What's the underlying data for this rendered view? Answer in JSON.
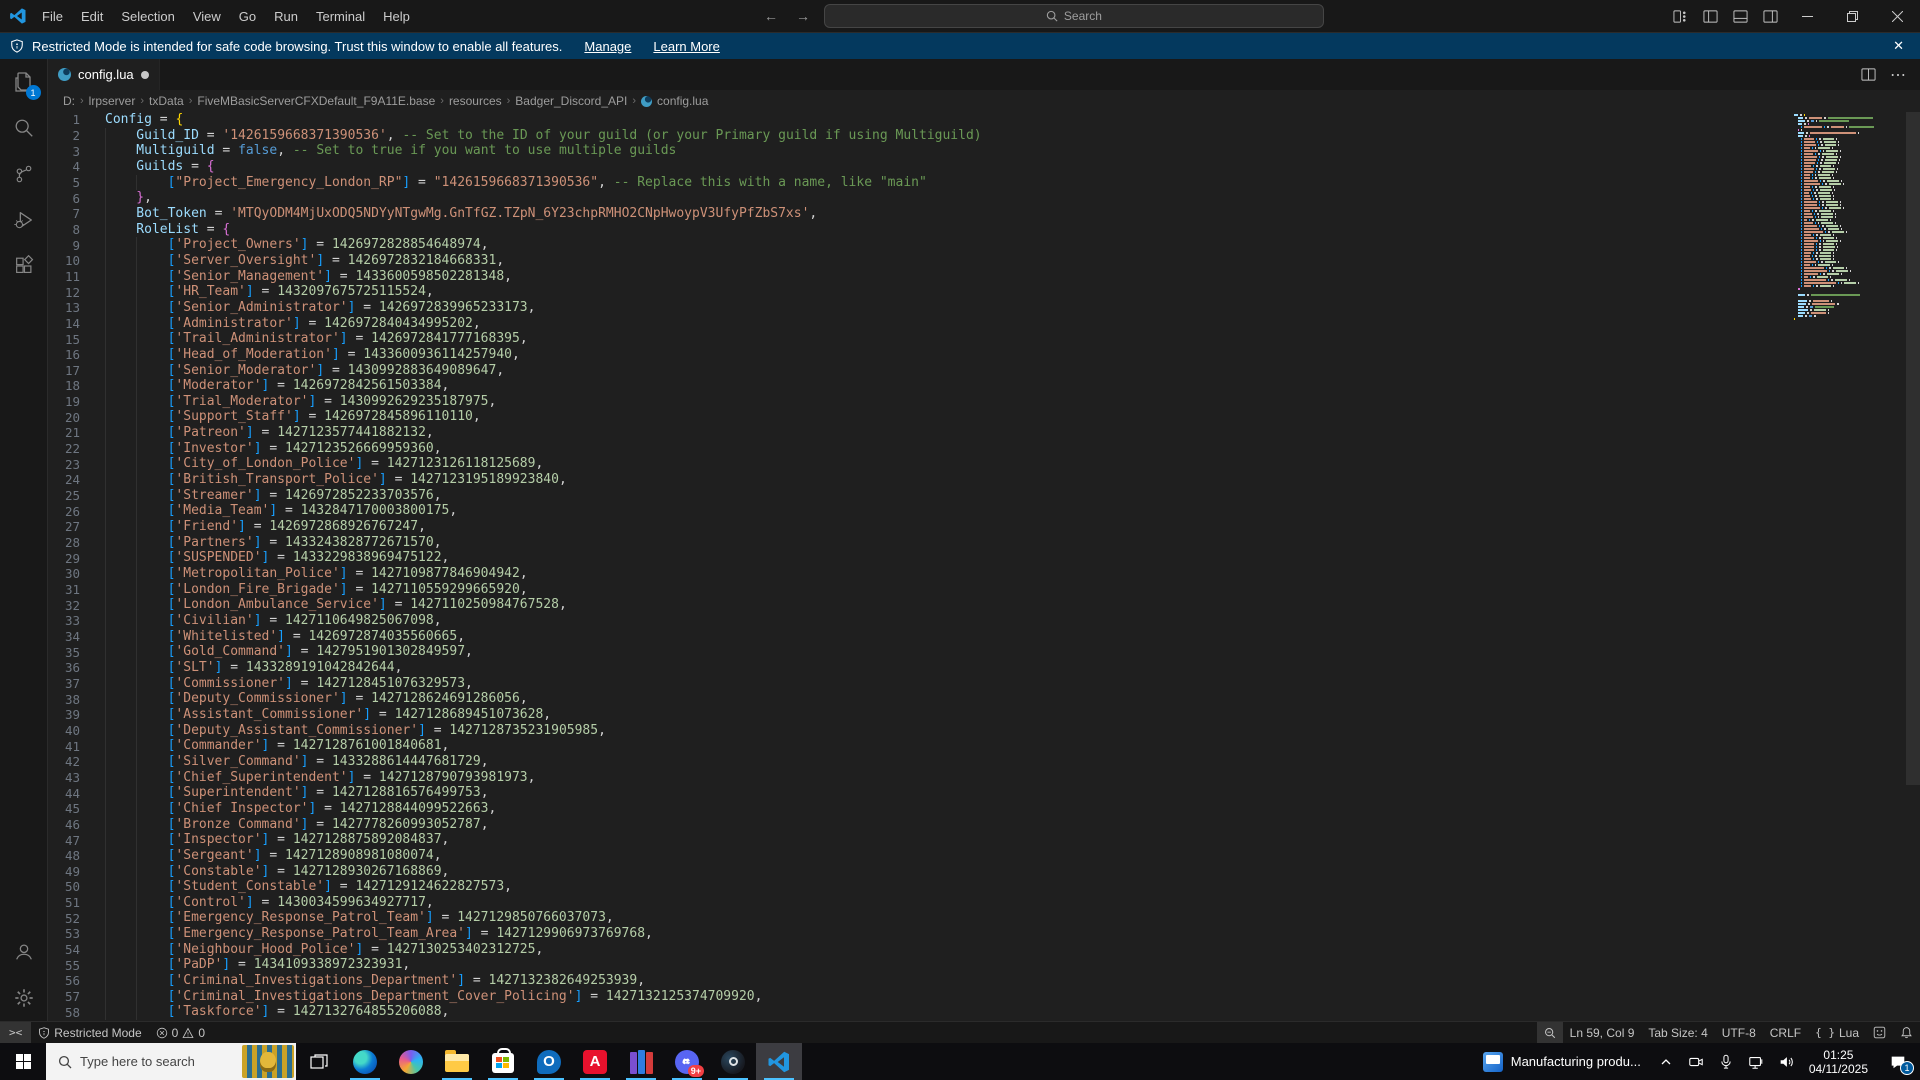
{
  "window": {
    "menus": [
      "File",
      "Edit",
      "Selection",
      "View",
      "Go",
      "Run",
      "Terminal",
      "Help"
    ],
    "search_placeholder": "Search"
  },
  "banner": {
    "text": "Restricted Mode is intended for safe code browsing. Trust this window to enable all features.",
    "manage": "Manage",
    "learn_more": "Learn More"
  },
  "tab": {
    "file": "config.lua"
  },
  "breadcrumb": [
    "D:",
    "lrpserver",
    "txData",
    "FiveMBasicServerCFXDefault_F9A11E.base",
    "resources",
    "Badger_Discord_API",
    "config.lua"
  ],
  "editor": {
    "head_lines": [
      {
        "ind": 0,
        "tokens": [
          [
            "v",
            "Config"
          ],
          [
            "o",
            " = "
          ],
          [
            "b1",
            "{"
          ]
        ]
      },
      {
        "ind": 1,
        "tokens": [
          [
            "v",
            "Guild_ID"
          ],
          [
            "o",
            " = "
          ],
          [
            "s",
            "'1426159668371390536'"
          ],
          [
            "o",
            ", "
          ],
          [
            "c",
            "-- Set to the ID of your guild (or your Primary guild if using Multiguild)"
          ]
        ]
      },
      {
        "ind": 1,
        "tokens": [
          [
            "v",
            "Multiguild"
          ],
          [
            "o",
            " = "
          ],
          [
            "k",
            "false"
          ],
          [
            "o",
            ", "
          ],
          [
            "c",
            "-- Set to true if you want to use multiple guilds"
          ]
        ]
      },
      {
        "ind": 1,
        "tokens": [
          [
            "v",
            "Guilds"
          ],
          [
            "o",
            " = "
          ],
          [
            "b2",
            "{"
          ]
        ]
      },
      {
        "ind": 2,
        "tokens": [
          [
            "b3",
            "["
          ],
          [
            "s",
            "\"Project_Emergency_London_RP\""
          ],
          [
            "b3",
            "]"
          ],
          [
            "o",
            " = "
          ],
          [
            "s",
            "\"1426159668371390536\""
          ],
          [
            "o",
            ", "
          ],
          [
            "c",
            "-- Replace this with a name, like \"main\""
          ]
        ]
      },
      {
        "ind": 1,
        "tokens": [
          [
            "b2",
            "}"
          ],
          [
            "o",
            ","
          ]
        ]
      },
      {
        "ind": 1,
        "tokens": [
          [
            "v",
            "Bot_Token"
          ],
          [
            "o",
            " = "
          ],
          [
            "s",
            "'MTQyODM4MjUxODQ5NDYyNTgwMg.GnTfGZ.TZpN_6Y23chpRMHO2CNpHwoypV3UfyPfZbS7xs'"
          ],
          [
            "o",
            ","
          ]
        ]
      },
      {
        "ind": 1,
        "tokens": [
          [
            "v",
            "RoleList"
          ],
          [
            "o",
            " = "
          ],
          [
            "b2",
            "{"
          ]
        ]
      }
    ],
    "roles": [
      [
        "Project_Owners",
        "1426972828854648974"
      ],
      [
        "Server_Oversight",
        "1426972832184668331"
      ],
      [
        "Senior_Management",
        "1433600598502281348"
      ],
      [
        "HR_Team",
        "1432097675725115524"
      ],
      [
        "Senior_Administrator",
        "1426972839965233173"
      ],
      [
        "Administrator",
        "1426972840434995202"
      ],
      [
        "Trail_Administrator",
        "1426972841777168395"
      ],
      [
        "Head_of_Moderation",
        "1433600936114257940"
      ],
      [
        "Senior_Moderator",
        "1430992883649089647"
      ],
      [
        "Moderator",
        "1426972842561503384"
      ],
      [
        "Trial_Moderator",
        "1430992629235187975"
      ],
      [
        "Support_Staff",
        "1426972845896110110"
      ],
      [
        "Patreon",
        "1427123577441882132"
      ],
      [
        "Investor",
        "1427123526669959360"
      ],
      [
        "City_of_London_Police",
        "1427123126118125689"
      ],
      [
        "British_Transport_Police",
        "1427123195189923840"
      ],
      [
        "Streamer",
        "1426972852233703576"
      ],
      [
        "Media_Team",
        "1432847170003800175"
      ],
      [
        "Friend",
        "1426972868926767247"
      ],
      [
        "Partners",
        "1433243828772671570"
      ],
      [
        "SUSPENDED",
        "1433229838969475122"
      ],
      [
        "Metropolitan_Police",
        "1427109877846904942"
      ],
      [
        "London_Fire_Brigade",
        "1427110559299665920"
      ],
      [
        "London_Ambulance_Service",
        "1427110250984767528"
      ],
      [
        "Civilian",
        "1427110649825067098"
      ],
      [
        "Whitelisted",
        "1426972874035560665"
      ],
      [
        "Gold_Command",
        "1427951901302849597"
      ],
      [
        "SLT",
        "1433289191042842644"
      ],
      [
        "Commissioner",
        "1427128451076329573"
      ],
      [
        "Deputy_Commissioner",
        "1427128624691286056"
      ],
      [
        "Assistant_Commissioner",
        "1427128689451073628"
      ],
      [
        "Deputy_Assistant_Commissioner",
        "1427128735231905985"
      ],
      [
        "Commander",
        "1427128761001840681"
      ],
      [
        "Silver_Command",
        "1433288614447681729"
      ],
      [
        "Chief_Superintendent",
        "1427128790793981973"
      ],
      [
        "Superintendent",
        "1427128816576499753"
      ],
      [
        "Chief Inspector",
        "1427128844099522663"
      ],
      [
        "Bronze Command",
        "1427778260993052787"
      ],
      [
        "Inspector",
        "1427128875892084837"
      ],
      [
        "Sergeant",
        "1427128908981080074"
      ],
      [
        "Constable",
        "1427128930267168869"
      ],
      [
        "Student_Constable",
        "1427129124622827573"
      ],
      [
        "Control",
        "1430034599634927717"
      ],
      [
        "Emergency_Response_Patrol_Team",
        "1427129850766037073"
      ],
      [
        "Emergency_Response_Patrol_Team_Area",
        "1427129906973769768"
      ],
      [
        "Neighbour_Hood_Police",
        "1427130253402312725"
      ],
      [
        "PaDP",
        "1434109338972323931"
      ],
      [
        "Criminal_Investigations_Department",
        "1427132382649253939"
      ],
      [
        "Criminal_Investigations_Department_Cover_Policing",
        "1427132125374709920"
      ],
      [
        "Taskforce",
        "1427132764855206088"
      ]
    ],
    "colors": {
      "variable": "#9CDCFE",
      "operator": "#D4D4D4",
      "string": "#CE9178",
      "comment": "#6A9955",
      "keyword": "#569CD6",
      "number": "#B5CEA8",
      "bracket1": "#FFD700",
      "bracket2": "#DA70D6",
      "bracket3": "#179FFF"
    }
  },
  "status": {
    "restricted": "Restricted Mode",
    "errors": "0",
    "warnings": "0",
    "ln_col": "Ln 59, Col 9",
    "tab_size": "Tab Size: 4",
    "encoding": "UTF-8",
    "eol": "CRLF",
    "language": "Lua"
  },
  "taskbar": {
    "search_placeholder": "Type here to search",
    "widget_text": "Manufacturing produ...",
    "time": "01:25",
    "date": "04/11/2025",
    "discord_badge": "9+",
    "notification_badge": "1",
    "explorer_badge": "1"
  }
}
